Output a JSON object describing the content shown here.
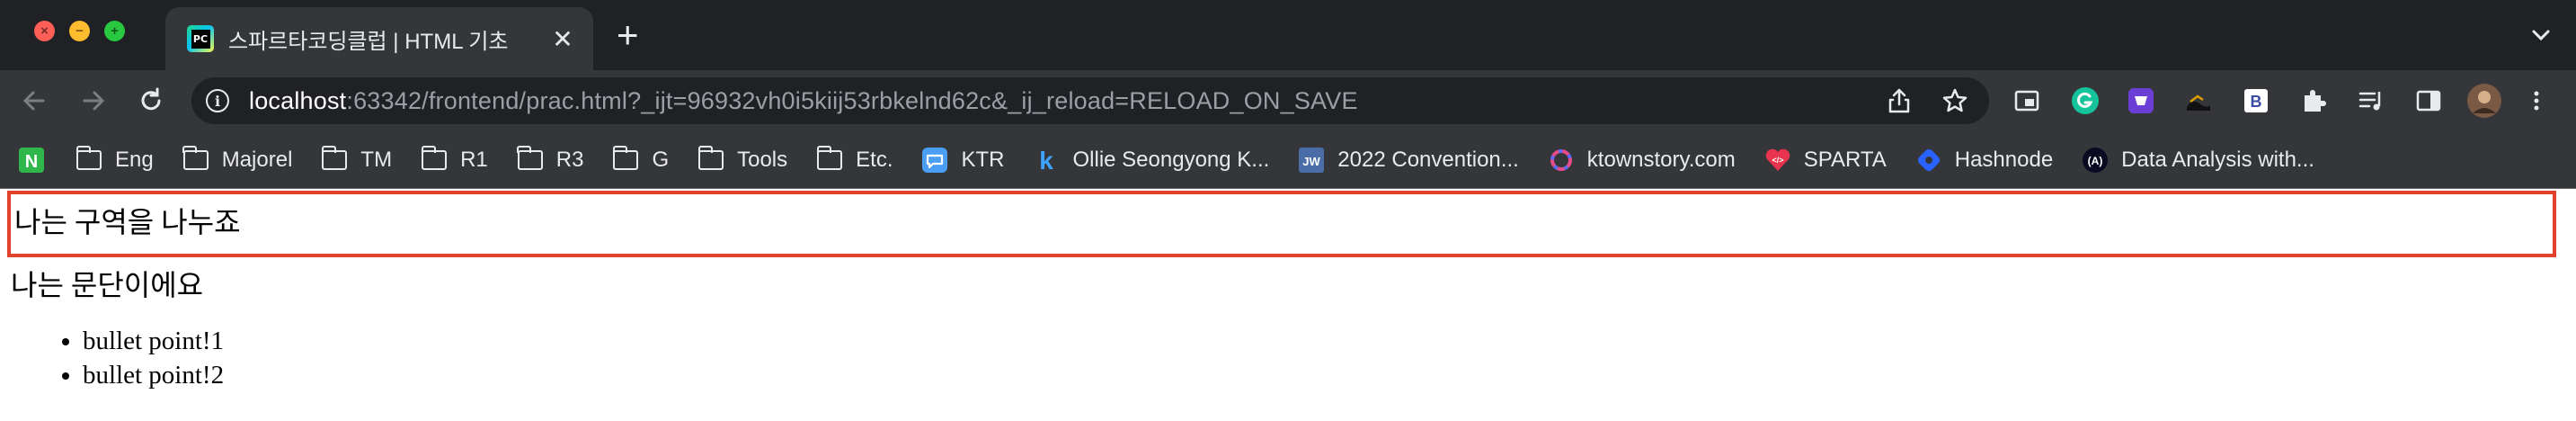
{
  "window": {
    "tab": {
      "title": "스파르타코딩클럽 | HTML 기초",
      "favicon_text": "PC"
    }
  },
  "toolbar": {
    "url_host": "localhost",
    "url_rest": ":63342/frontend/prac.html?_ijt=96932vh0i5kiij53rbkelnd62c&_ij_reload=RELOAD_ON_SAVE"
  },
  "bookmarks": [
    {
      "label": "",
      "icon": "notion-n-icon"
    },
    {
      "label": "Eng",
      "icon": "folder-icon"
    },
    {
      "label": "Majorel",
      "icon": "folder-icon"
    },
    {
      "label": "TM",
      "icon": "folder-icon"
    },
    {
      "label": "R1",
      "icon": "folder-icon"
    },
    {
      "label": "R3",
      "icon": "folder-icon"
    },
    {
      "label": "G",
      "icon": "folder-icon"
    },
    {
      "label": "Tools",
      "icon": "folder-icon"
    },
    {
      "label": "Etc.",
      "icon": "folder-icon"
    },
    {
      "label": "KTR",
      "icon": "chat-bubble-icon"
    },
    {
      "label": "Ollie Seongyong K...",
      "icon": "k-logo-icon"
    },
    {
      "label": "2022 Convention...",
      "icon": "jw-logo-icon"
    },
    {
      "label": "ktownstory.com",
      "icon": "ring-logo-icon"
    },
    {
      "label": "SPARTA",
      "icon": "sparta-logo-icon"
    },
    {
      "label": "Hashnode",
      "icon": "hashnode-logo-icon"
    },
    {
      "label": "Data Analysis with...",
      "icon": "a-logo-icon"
    }
  ],
  "page": {
    "div_text": "나는 구역을 나누죠",
    "p_text": "나는 문단이에요",
    "list_items": [
      "bullet point!1",
      "bullet point!2"
    ]
  },
  "colors": {
    "div_border": "#e2422b",
    "chrome_bg": "#35363a",
    "tabstrip_bg": "#202124"
  }
}
